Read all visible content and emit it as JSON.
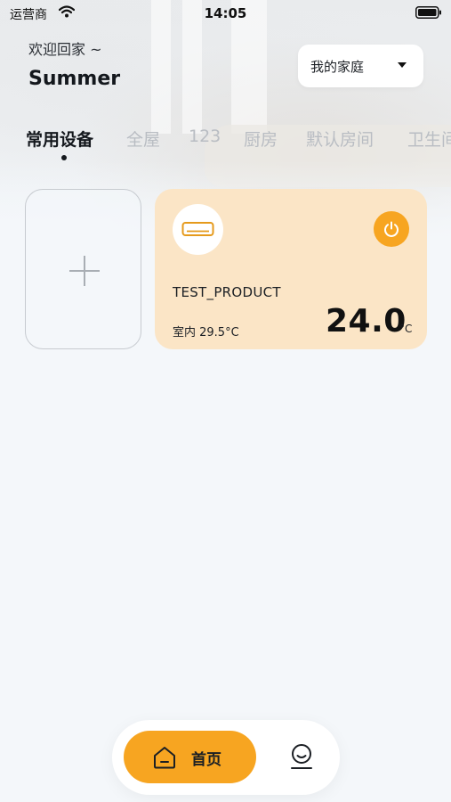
{
  "status_bar": {
    "carrier": "运营商",
    "time": "14:05"
  },
  "header": {
    "greeting": "欢迎回家 ~",
    "user_name": "Summer",
    "home_select_value": "我的家庭"
  },
  "tabs": [
    {
      "label": "常用设备",
      "active": true
    },
    {
      "label": "全屋",
      "active": false
    },
    {
      "label": "123",
      "active": false
    },
    {
      "label": "厨房",
      "active": false
    },
    {
      "label": "默认房间",
      "active": false
    },
    {
      "label": "卫生间",
      "active": false
    }
  ],
  "device_card": {
    "name": "TEST_PRODUCT",
    "indoor_temp": "室内 29.5°C",
    "set_temp": "24.0",
    "unit": "°C",
    "icon": "air-conditioner-icon",
    "power_icon": "power-icon"
  },
  "add_card": {
    "icon": "plus-icon"
  },
  "bottom_nav": {
    "home_label": "首页",
    "home_icon": "home-icon",
    "profile_icon": "profile-icon"
  },
  "colors": {
    "accent": "#f7a521",
    "device_card_bg": "#fbe5c6",
    "page_bg": "#f4f7fa"
  }
}
